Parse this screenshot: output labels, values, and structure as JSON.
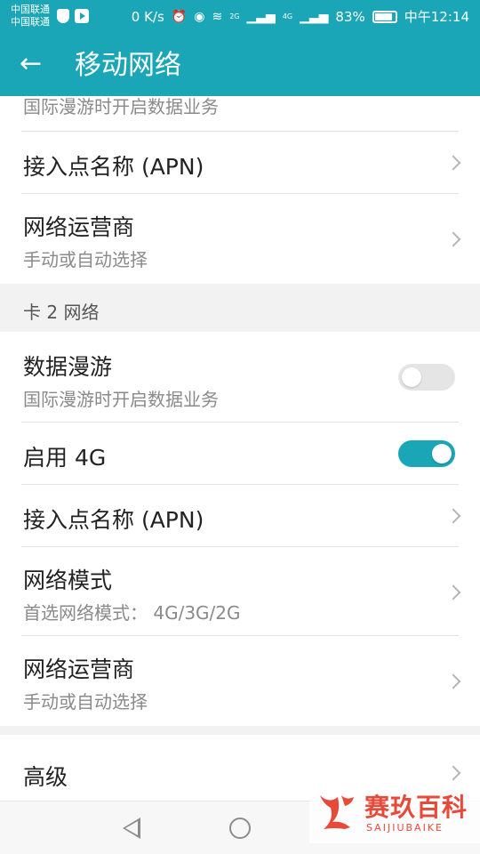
{
  "status_bar": {
    "carrier_1": "中国联通",
    "carrier_2": "中国联通",
    "speed": "0 K/s",
    "network_badge_1": "2G",
    "network_badge_2": "4G",
    "battery": "83%",
    "time": "中午12:14",
    "icons": [
      "shield-icon",
      "play-icon",
      "alarm-icon",
      "eye-icon",
      "wifi-icon",
      "signal-icon",
      "battery-icon"
    ]
  },
  "toolbar": {
    "title": "移动网络",
    "back_icon": "arrow-left-icon"
  },
  "card1": {
    "partial_subtitle": "国际漫游时开启数据业务",
    "rows": [
      {
        "title": "接入点名称 (APN)"
      },
      {
        "title": "网络运营商",
        "subtitle": "手动或自动选择"
      }
    ]
  },
  "card2": {
    "header": "卡 2 网络",
    "data_roaming": {
      "title": "数据漫游",
      "subtitle": "国际漫游时开启数据业务",
      "enabled": false
    },
    "enable_4g": {
      "title": "启用 4G",
      "enabled": true
    },
    "apn": {
      "title": "接入点名称 (APN)"
    },
    "network_mode": {
      "title": "网络模式",
      "subtitle": "首选网络模式： 4G/3G/2G"
    },
    "operator": {
      "title": "网络运营商",
      "subtitle": "手动或自动选择"
    }
  },
  "advanced": {
    "title": "高级"
  },
  "nav": {
    "icons": [
      "nav-back-icon",
      "nav-home-icon"
    ]
  },
  "watermark": {
    "text_cn": "赛玖百科",
    "text_en": "SAIJIUBAIKE"
  },
  "colors": {
    "accent": "#1aa6b7",
    "switch_off": "#e5e5e5",
    "watermark": "#e84a3a"
  }
}
